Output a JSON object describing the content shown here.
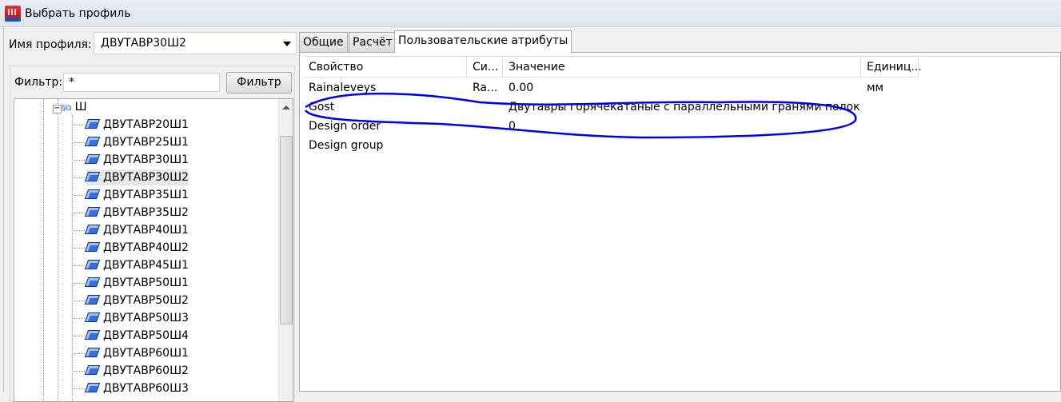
{
  "window": {
    "title": "Выбрать профиль"
  },
  "profile": {
    "label": "Имя профиля:",
    "value": "ДВУТАВР30Ш2"
  },
  "filter": {
    "label": "Фильтр:",
    "value": "*",
    "button": "Фильтр"
  },
  "tree": {
    "group": "Ш",
    "items": [
      "ДВУТАВР20Ш1",
      "ДВУТАВР25Ш1",
      "ДВУТАВР30Ш1",
      "ДВУТАВР30Ш2",
      "ДВУТАВР35Ш1",
      "ДВУТАВР35Ш2",
      "ДВУТАВР40Ш1",
      "ДВУТАВР40Ш2",
      "ДВУТАВР45Ш1",
      "ДВУТАВР50Ш1",
      "ДВУТАВР50Ш2",
      "ДВУТАВР50Ш3",
      "ДВУТАВР50Ш4",
      "ДВУТАВР60Ш1",
      "ДВУТАВР60Ш2",
      "ДВУТАВР60Ш3"
    ],
    "selected": "ДВУТАВР30Ш2"
  },
  "tabs": [
    "Общие",
    "Расчёт",
    "Пользовательские атрибуты"
  ],
  "table": {
    "columns": [
      "Свойство",
      "Си...",
      "Значение",
      "Единиц..."
    ],
    "rows": [
      [
        "Rainaleveys",
        "Ra...",
        "0.00",
        "мм"
      ],
      [
        "Gost",
        "",
        "Двутавры горячекатаные с параллельными гранями полок ...",
        ""
      ],
      [
        "Design order",
        "",
        "0",
        ""
      ],
      [
        "Design group",
        "",
        "",
        ""
      ]
    ]
  },
  "annotation_color": "#0000e0"
}
